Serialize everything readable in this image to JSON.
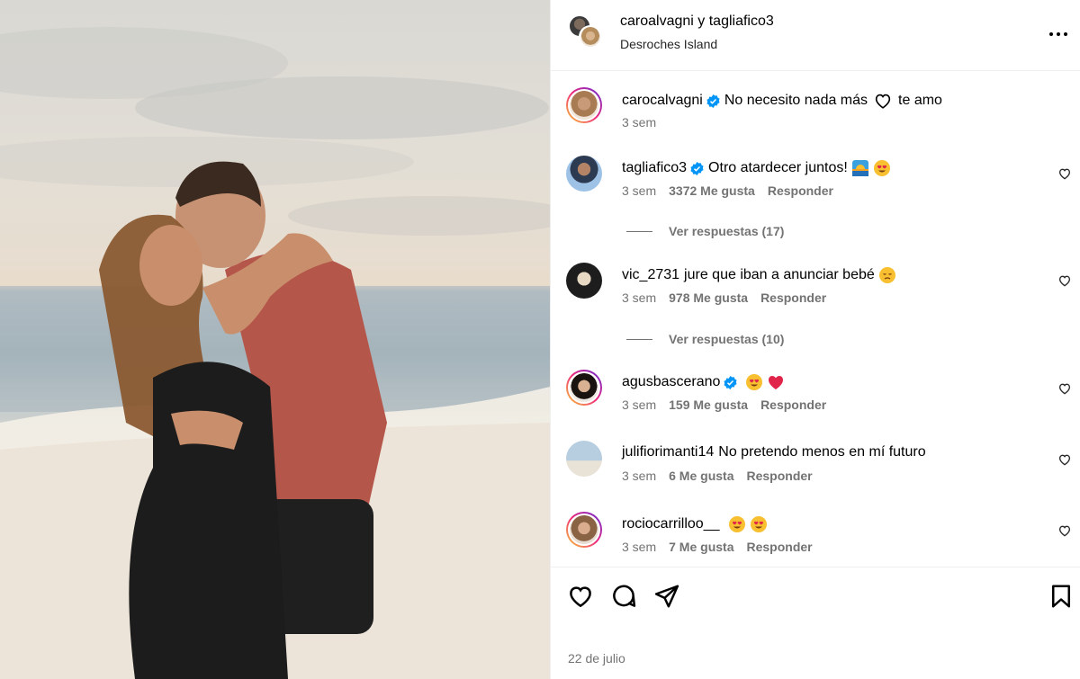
{
  "header": {
    "user1": "caroalvagni",
    "joiner": "y",
    "user2": "tagliafico3",
    "location": "Desroches Island"
  },
  "caption": {
    "user": "carocalvagni",
    "text_before": "No necesito nada más",
    "text_after": "te amo",
    "time": "3 sem"
  },
  "comments": [
    {
      "user": "tagliafico3",
      "verified": true,
      "text": "Otro atardecer juntos!",
      "emojis": [
        "sunset-emoji",
        "heart-eyes-emoji"
      ],
      "time": "3 sem",
      "likes": "3372 Me gusta",
      "reply": "Responder",
      "view_replies": "Ver respuestas (17)"
    },
    {
      "user": "vic_2731",
      "verified": false,
      "text": "jure que iban a anunciar bebé",
      "emojis": [
        "sad-face-emoji"
      ],
      "time": "3 sem",
      "likes": "978 Me gusta",
      "reply": "Responder",
      "view_replies": "Ver respuestas (10)"
    },
    {
      "user": "agusbascerano",
      "verified": true,
      "text": "",
      "emojis": [
        "heart-eyes-emoji",
        "red-heart-emoji"
      ],
      "time": "3 sem",
      "likes": "159 Me gusta",
      "reply": "Responder"
    },
    {
      "user": "julifiorimanti14",
      "verified": false,
      "text": "No pretendo menos en mí futuro",
      "emojis": [],
      "time": "3 sem",
      "likes": "6 Me gusta",
      "reply": "Responder"
    },
    {
      "user": "rociocarrilloo__",
      "verified": false,
      "text": "",
      "emojis": [
        "heart-eyes-emoji",
        "heart-eyes-emoji"
      ],
      "time": "3 sem",
      "likes": "7 Me gusta",
      "reply": "Responder"
    }
  ],
  "footer": {
    "date": "22 de julio"
  },
  "colors": {
    "verified": "#0095f6",
    "secondary_text": "#737373",
    "divider": "#efefef"
  }
}
